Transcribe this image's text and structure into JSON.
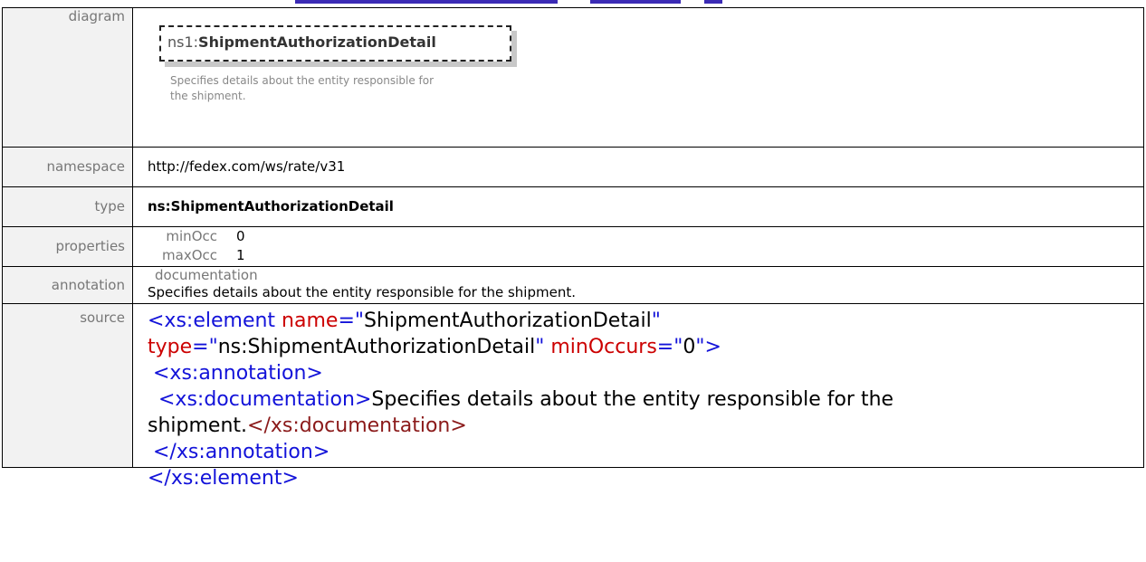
{
  "rows": {
    "diagram": {
      "label": "diagram",
      "box_prefix": "ns1:",
      "box_name": "ShipmentAuthorizationDetail",
      "box_description": "Specifies details about the entity responsible for the shipment."
    },
    "namespace": {
      "label": "namespace",
      "value": "http://fedex.com/ws/rate/v31"
    },
    "type": {
      "label": "type",
      "value": "ns:ShipmentAuthorizationDetail"
    },
    "properties": {
      "label": "properties",
      "items": [
        {
          "name": "minOcc",
          "value": "0"
        },
        {
          "name": "maxOcc",
          "value": "1"
        }
      ]
    },
    "annotation": {
      "label": "annotation",
      "heading": "documentation",
      "text": "Specifies details about the entity responsible for the shipment."
    },
    "source": {
      "label": "source",
      "line1_tag": "<xs:element",
      "line1_attr1": "name",
      "line1_eq1": "=\"",
      "line1_val1": "ShipmentAuthorizationDetail",
      "line1_q1": "\"",
      "line2_attr2": "type",
      "line2_eq2": "=\"",
      "line2_val2": "ns:ShipmentAuthorizationDetail",
      "line2_q2": "\"",
      "line2_attr3": "minOccurs",
      "line2_eq3": "=\"",
      "line2_val3": "0",
      "line2_q3": "\">",
      "line3_tag": "<xs:annotation>",
      "line4_tag": "<xs:documentation>",
      "line4_text": "Specifies details about the entity responsible for the",
      "line5_text": "shipment.",
      "line5_tag": "</xs:documentation>",
      "line6_tag": "</xs:annotation>",
      "line7_tag": "</xs:element>"
    }
  }
}
